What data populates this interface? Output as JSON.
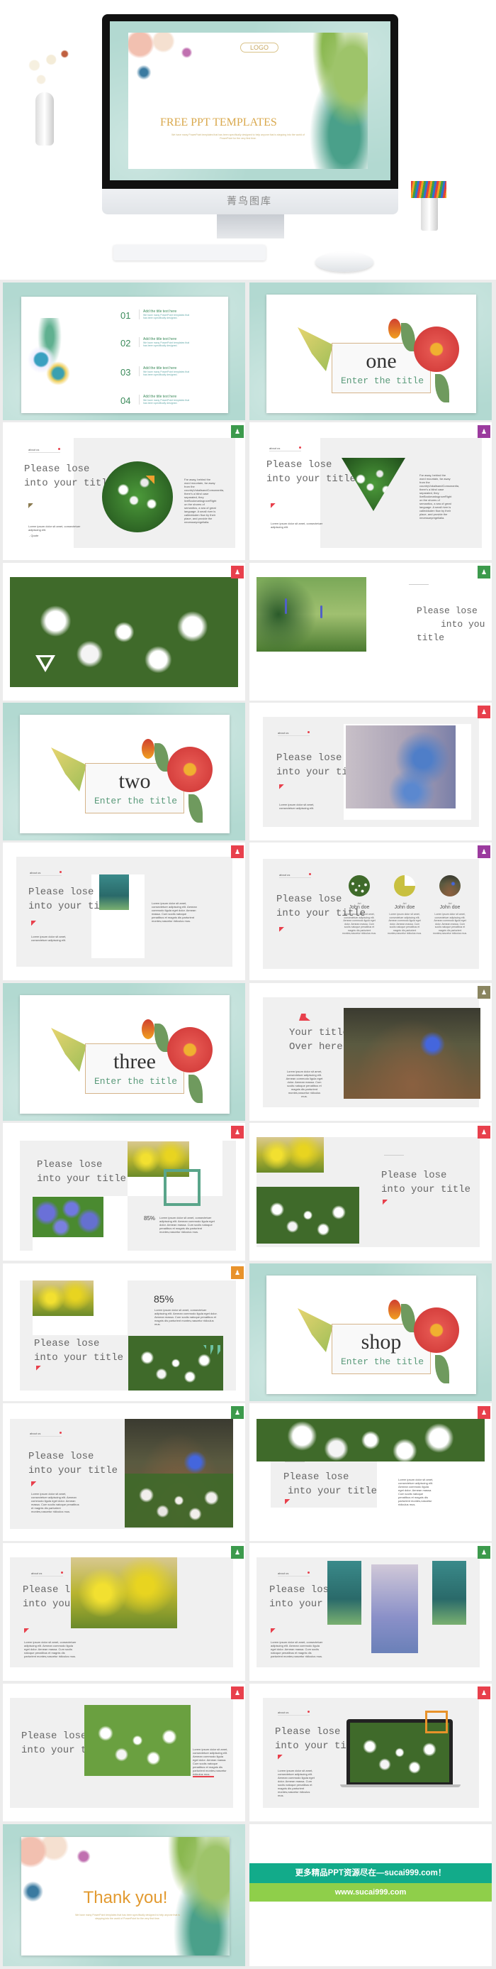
{
  "hero": {
    "logo": "LOGO",
    "title": "FREE PPT TEMPLATES",
    "subtitle": "We have many PowerPoint templates that has been specifically designed to help anyone that is stepping into the world of PowerPoint for the very first time.",
    "brand": "菁鸟图库"
  },
  "toc": {
    "items": [
      {
        "num": "01",
        "title": "Add the title text here",
        "desc": "We have many PowerPoint templates that has been specifically designed."
      },
      {
        "num": "02",
        "title": "Add the title text here",
        "desc": "We have many PowerPoint templates that has been specifically designed."
      },
      {
        "num": "03",
        "title": "Add the title text here",
        "desc": "We have many PowerPoint templates that has been specifically designed."
      },
      {
        "num": "04",
        "title": "Add the title text here",
        "desc": "We have many PowerPoint templates that has been specifically designed."
      }
    ]
  },
  "chapters": {
    "one": "one",
    "two": "two",
    "three": "three",
    "shop": "shop",
    "subtitle": "Enter the title"
  },
  "common": {
    "tag": "about us",
    "title_line1": "Please lose",
    "title_line2": "into your title",
    "title_alt_line2": "into you",
    "title_alt_line3": "title",
    "title2_line1": "Your title",
    "title2_line2": "Over here",
    "short_text": "Lorem ipsum dolor sit amet, consectetuer adipiscing elit.",
    "quote": "- Quote",
    "story": "Far away, behind the word mountain, far away from the countryVokalisandConsonantia, there's a blind case separated, they liveBookmarksgroveRight on the shores of semantics, a sea of great language. A small river is calledduden flow by their place, and provide the necessaryregelialia.",
    "lorem": "Lorem ipsum dolor sit amet, consectetuer adipiscing elit. Aenean commodo ligula eget dolor. Aenean massa. Cum sociis natoque penatibus et magnis dis parturient montes,nascetur ridiculus mus.",
    "percent": "85%"
  },
  "team": {
    "members": [
      {
        "role": "Art",
        "name": "John doe"
      },
      {
        "role": "Art",
        "name": "John doe"
      },
      {
        "role": "Art",
        "name": "John doe"
      }
    ]
  },
  "thanks": {
    "title": "Thank you!",
    "subtitle": "We have many PowerPoint templates that has been specifically designed to help anyone that is stepping into the world of PowerPoint for the very first time."
  },
  "banner": {
    "line1": "更多精品PPT资源尽在—sucai999.com！",
    "line2": "www.sucai999.com"
  },
  "colors": {
    "mint": "#b2d9d1",
    "green_badge": "#3c9a4c",
    "purple_badge": "#9b3a9e",
    "red_badge": "#e8404c",
    "olive_badge": "#8a8560",
    "orange_badge": "#e8922a",
    "banner_teal": "#12ab8a",
    "banner_green": "#8fcf4a"
  },
  "icons": {
    "badge": "person-icon"
  }
}
